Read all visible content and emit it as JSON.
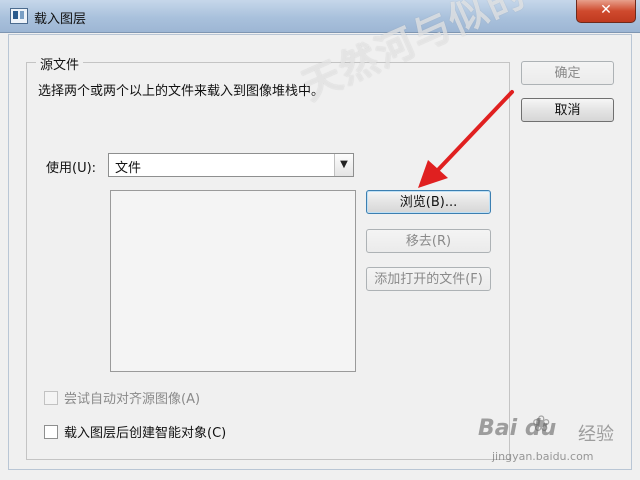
{
  "window": {
    "title": "载入图层",
    "close_label": "✕",
    "app_icon": "photoshop-dialog-icon"
  },
  "source_group": {
    "title": "源文件",
    "description": "选择两个或两个以上的文件来载入到图像堆栈中。"
  },
  "use": {
    "label": "使用(U):",
    "selected": "文件"
  },
  "buttons": {
    "ok": "确定",
    "cancel": "取消",
    "browse": "浏览(B)...",
    "remove": "移去(R)",
    "add_open": "添加打开的文件(F)"
  },
  "options": {
    "auto_align": {
      "label": "尝试自动对齐源图像(A)",
      "checked": false,
      "enabled": false
    },
    "smart_object": {
      "label": "载入图层后创建智能对象(C)",
      "checked": false,
      "enabled": true
    }
  },
  "watermarks": {
    "overlay": "天然河与似的",
    "baidu_main": "Bai du",
    "baidu_jingyan": "经验",
    "baidu_url": "jingyan.baidu.com"
  },
  "colors": {
    "arrow": "#e02020"
  }
}
